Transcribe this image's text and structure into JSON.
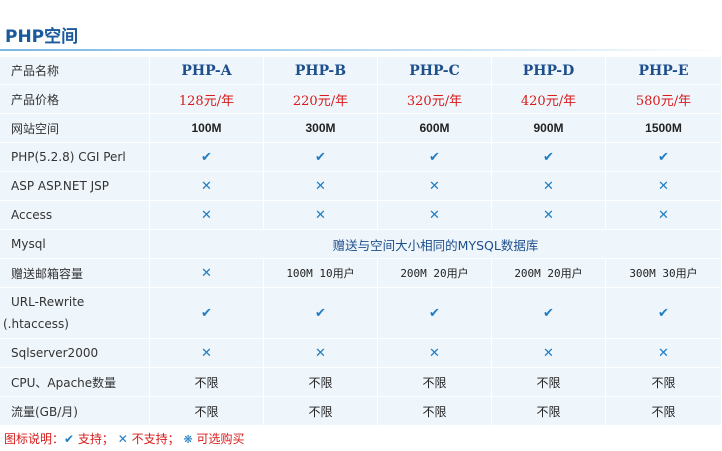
{
  "page_title": "PHP空间",
  "colors": {
    "title": "#1a5a9c",
    "plan_name": "#1e4f8d",
    "price": "#d81a1a",
    "icon": "#1f7dc4",
    "row_bg": "#eef5fb",
    "legend": "#d81a1a"
  },
  "rows": {
    "product_name": {
      "label": "产品名称",
      "plans": [
        "PHP-A",
        "PHP-B",
        "PHP-C",
        "PHP-D",
        "PHP-E"
      ]
    },
    "price": {
      "label": "产品价格",
      "values": [
        "128元/年",
        "220元/年",
        "320元/年",
        "420元/年",
        "580元/年"
      ]
    },
    "web_space": {
      "label": "网站空间",
      "values": [
        "100M",
        "300M",
        "600M",
        "900M",
        "1500M"
      ]
    },
    "php_cgi": {
      "label": "PHP(5.2.8) CGI Perl",
      "icons": [
        "check-icon",
        "check-icon",
        "check-icon",
        "check-icon",
        "check-icon"
      ]
    },
    "asp": {
      "label": "ASP ASP.NET JSP",
      "icons": [
        "cross-icon",
        "cross-icon",
        "cross-icon",
        "cross-icon",
        "cross-icon"
      ]
    },
    "access": {
      "label": "Access",
      "icons": [
        "cross-icon",
        "cross-icon",
        "cross-icon",
        "cross-icon",
        "cross-icon"
      ]
    },
    "mysql": {
      "label": "Mysql",
      "value": "赠送与空间大小相同的MYSQL数据库"
    },
    "email": {
      "label": "赠送邮箱容量",
      "icon0": "cross-icon",
      "values": [
        "100M 10用户",
        "200M 20用户",
        "200M 20用户",
        "300M 30用户"
      ]
    },
    "rewrite": {
      "label_line1": "URL-Rewrite",
      "label_line2": "(.htaccess)",
      "icons": [
        "check-icon",
        "check-icon",
        "check-icon",
        "check-icon",
        "check-icon"
      ]
    },
    "sqlserver": {
      "label": "Sqlserver2000",
      "icons": [
        "cross-icon",
        "cross-icon",
        "cross-icon",
        "cross-icon",
        "cross-icon"
      ]
    },
    "cpu": {
      "label": "CPU、Apache数量",
      "values": [
        "不限",
        "不限",
        "不限",
        "不限",
        "不限"
      ]
    },
    "traffic": {
      "label": "流量(GB/月)",
      "values": [
        "不限",
        "不限",
        "不限",
        "不限",
        "不限"
      ]
    }
  },
  "symbols": {
    "check": "✔",
    "cross": "✕",
    "optional": "❋"
  },
  "legend": {
    "prefix": "图标说明：",
    "supported": "支持；",
    "unsupported": "不支持；",
    "optional": "可选购买"
  }
}
